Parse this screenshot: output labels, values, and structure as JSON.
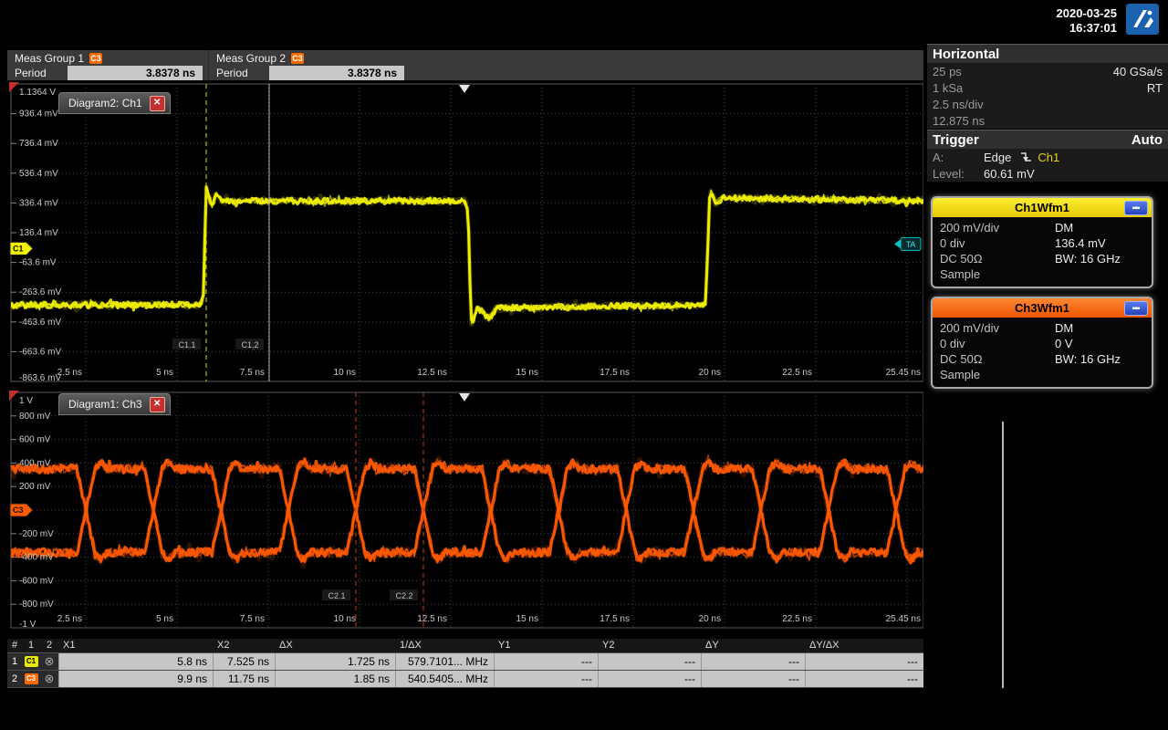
{
  "clock": {
    "date": "2020-03-25",
    "time": "16:37:01"
  },
  "logo_text": "R&S",
  "colors": {
    "ch1": "#f2f200",
    "ch3": "#ff5a00",
    "grid": "#474747",
    "cursor_yellow": "#d8d800",
    "cursor_gray": "#b4b4b4",
    "cursor_orange": "#c84000",
    "trigger_cyan": "#00c8c8"
  },
  "meas_bar": {
    "groups": [
      {
        "title": "Meas Group 1",
        "badge": "C3",
        "badge_color": "#ff6a00",
        "label": "Period",
        "value": "3.8378 ns"
      },
      {
        "title": "Meas Group 2",
        "badge": "C3",
        "badge_color": "#ff6a00",
        "label": "Period",
        "value": "3.8378 ns"
      }
    ]
  },
  "sidebar": {
    "horizontal": {
      "title": "Horizontal",
      "rows": [
        [
          "25 ps",
          "40 GSa/s"
        ],
        [
          "1 kSa",
          "RT"
        ],
        [
          "2.5 ns/div",
          ""
        ],
        [
          "12.875 ns",
          ""
        ]
      ]
    },
    "trigger": {
      "title": "Trigger",
      "mode": "Auto",
      "source_label": "A:",
      "type": "Edge",
      "channel": "Ch1",
      "level_label": "Level:",
      "level": "60.61 mV"
    },
    "ch1_box": {
      "title": "Ch1Wfm1",
      "rows": [
        [
          "200 mV/div",
          "DM"
        ],
        [
          "0 div",
          "136.4 mV"
        ],
        [
          "DC 50Ω",
          "BW: 16 GHz"
        ],
        [
          "Sample",
          ""
        ]
      ]
    },
    "ch3_box": {
      "title": "Ch3Wfm1",
      "rows": [
        [
          "200 mV/div",
          "DM"
        ],
        [
          "0 div",
          "0 V"
        ],
        [
          "DC 50Ω",
          "BW: 16 GHz"
        ],
        [
          "Sample",
          ""
        ]
      ]
    }
  },
  "diagram2": {
    "tab": "Diagram2: Ch1",
    "channel_marker": "C1",
    "trigger_marker": "TA",
    "y_labels": [
      "1.1364 V",
      "936.4 mV",
      "736.4 mV",
      "536.4 mV",
      "336.4 mV",
      "136.4 mV",
      "-63.6 mV",
      "-263.6 mV",
      "-463.6 mV",
      "-663.6 mV",
      "-863.6 mV"
    ],
    "x_labels": [
      "2.5 ns",
      "5 ns",
      "7.5 ns",
      "10 ns",
      "12.5 ns",
      "15 ns",
      "17.5 ns",
      "20 ns",
      "22.5 ns",
      "25.45 ns"
    ],
    "cursors": [
      {
        "label": "C1.1",
        "t": 5.8,
        "dashed": true,
        "color": "#d8d800"
      },
      {
        "label": "C1.2",
        "t": 7.525,
        "dashed": false,
        "color": "#b4b4b4"
      }
    ]
  },
  "diagram1": {
    "tab": "Diagram1: Ch3",
    "channel_marker": "C3",
    "y_labels": [
      "1 V",
      "800 mV",
      "600 mV",
      "400 mV",
      "200 mV",
      "",
      "-200 mV",
      "-400 mV",
      "-600 mV",
      "-800 mV",
      "-1 V"
    ],
    "x_labels": [
      "2.5 ns",
      "5 ns",
      "7.5 ns",
      "10 ns",
      "12.5 ns",
      "15 ns",
      "17.5 ns",
      "20 ns",
      "22.5 ns",
      "25.45 ns"
    ],
    "cursors": [
      {
        "label": "C2.1",
        "t": 9.9,
        "dashed": true,
        "color": "#c84000"
      },
      {
        "label": "C2.2",
        "t": 11.75,
        "dashed": true,
        "color": "#c84000"
      }
    ]
  },
  "table": {
    "headers": [
      "#",
      "1",
      "2",
      "X1",
      "X2",
      "ΔX",
      "1/ΔX",
      "Y1",
      "Y2",
      "ΔY",
      "ΔY/ΔX"
    ],
    "rows": [
      {
        "num": "1",
        "badge": "C1",
        "badge_color": "#e8e800",
        "badge_text_color": "#000000",
        "values": [
          "5.8 ns",
          "7.525 ns",
          "1.725 ns",
          "579.7101... MHz",
          "---",
          "---",
          "---",
          "---"
        ]
      },
      {
        "num": "2",
        "badge": "C3",
        "badge_color": "#ff6a00",
        "badge_text_color": "#ffffff",
        "values": [
          "9.9 ns",
          "11.75 ns",
          "1.85 ns",
          "540.5405... MHz",
          "---",
          "---",
          "---",
          "---"
        ]
      }
    ]
  },
  "waveforms": {
    "t_start": 0.45,
    "t_end": 25.45,
    "ch1": {
      "color": "#f2f200",
      "high": 0.35,
      "low": -0.35,
      "noise": 0.02,
      "points": [
        [
          0.45,
          -0.35
        ],
        [
          5.63,
          -0.35
        ],
        [
          5.72,
          -0.31
        ],
        [
          5.8,
          0.44
        ],
        [
          5.95,
          0.32
        ],
        [
          6.08,
          0.4
        ],
        [
          6.25,
          0.35
        ],
        [
          12.88,
          0.35
        ],
        [
          12.97,
          0.3
        ],
        [
          13.06,
          -0.47
        ],
        [
          13.25,
          -0.37
        ],
        [
          13.55,
          -0.44
        ],
        [
          13.75,
          -0.37
        ],
        [
          19.48,
          -0.35
        ],
        [
          19.6,
          0.42
        ],
        [
          19.75,
          0.33
        ],
        [
          19.95,
          0.37
        ],
        [
          25.45,
          0.35
        ]
      ]
    },
    "ch3": {
      "color": "#ff5a00",
      "high": 0.35,
      "low": -0.36,
      "noise": 0.036,
      "crossings": [
        2.5,
        4.35,
        6.2,
        8.05,
        9.9,
        11.75,
        13.6,
        15.45,
        17.3,
        19.15,
        21.0,
        22.85,
        24.7
      ]
    }
  }
}
